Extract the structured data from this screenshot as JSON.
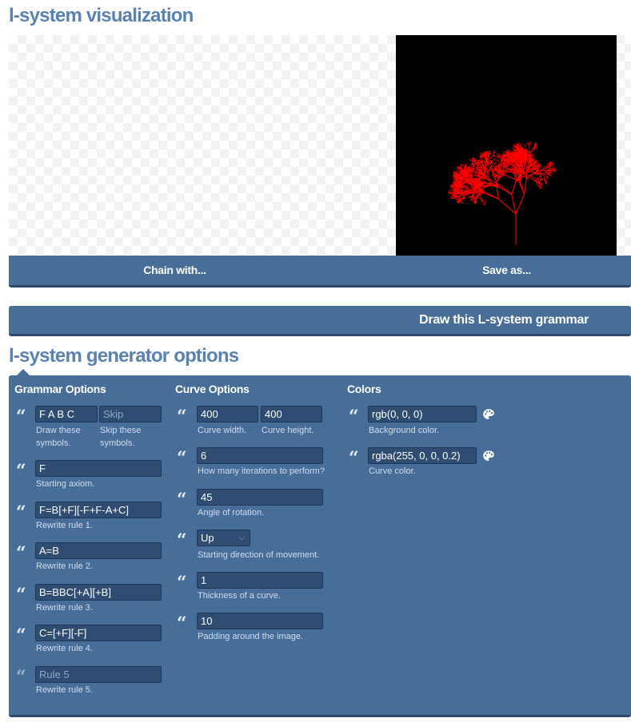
{
  "page": {
    "viz_title": "l-system visualization",
    "options_title": "l-system generator options"
  },
  "actions": {
    "chain_label": "Chain with...",
    "save_label": "Save as...",
    "draw_label": "Draw this L-system grammar"
  },
  "grammar": {
    "heading": "Grammar Options",
    "draw_symbols": {
      "value": "F A B C",
      "caption": "Draw these symbols."
    },
    "skip_symbols": {
      "placeholder": "Skip",
      "caption": "Skip these symbols."
    },
    "axiom": {
      "value": "F",
      "caption": "Starting axiom."
    },
    "rules": [
      {
        "value": " F=B[+F][-F+F-A+C]",
        "caption": "Rewrite rule 1."
      },
      {
        "value": "A=B",
        "caption": "Rewrite rule 2."
      },
      {
        "value": "B=BBC[+A][+B]",
        "caption": "Rewrite rule 3."
      },
      {
        "value": "C=[+F][-F]",
        "caption": "Rewrite rule 4."
      },
      {
        "placeholder": "Rule 5",
        "caption": "Rewrite rule 5."
      }
    ]
  },
  "curve": {
    "heading": "Curve Options",
    "width": {
      "value": "400",
      "caption": "Curve width."
    },
    "height": {
      "value": "400",
      "caption": "Curve height."
    },
    "iterations": {
      "value": "6",
      "caption": "How many iterations to perform?"
    },
    "angle": {
      "value": "45",
      "caption": "Angle of rotation."
    },
    "direction": {
      "value": "Up",
      "caption": "Starting direction of movement."
    },
    "thickness": {
      "value": "1",
      "caption": "Thickness of a curve."
    },
    "padding": {
      "value": "10",
      "caption": "Padding around the image."
    }
  },
  "colors": {
    "heading": "Colors",
    "background": {
      "value": "rgb(0, 0, 0)",
      "caption": "Background color."
    },
    "curve": {
      "value": "rgba(255, 0, 0, 0.2)",
      "caption": "Curve color."
    }
  },
  "theme": {
    "accent": "#476d99",
    "title": "#5a82b0",
    "canvas_bg": "#000000",
    "curve_stroke": "#ff0000"
  },
  "icons": {
    "quote": "quote-icon",
    "palette": "palette-icon",
    "select_arrow": "chevron-down-icon"
  }
}
